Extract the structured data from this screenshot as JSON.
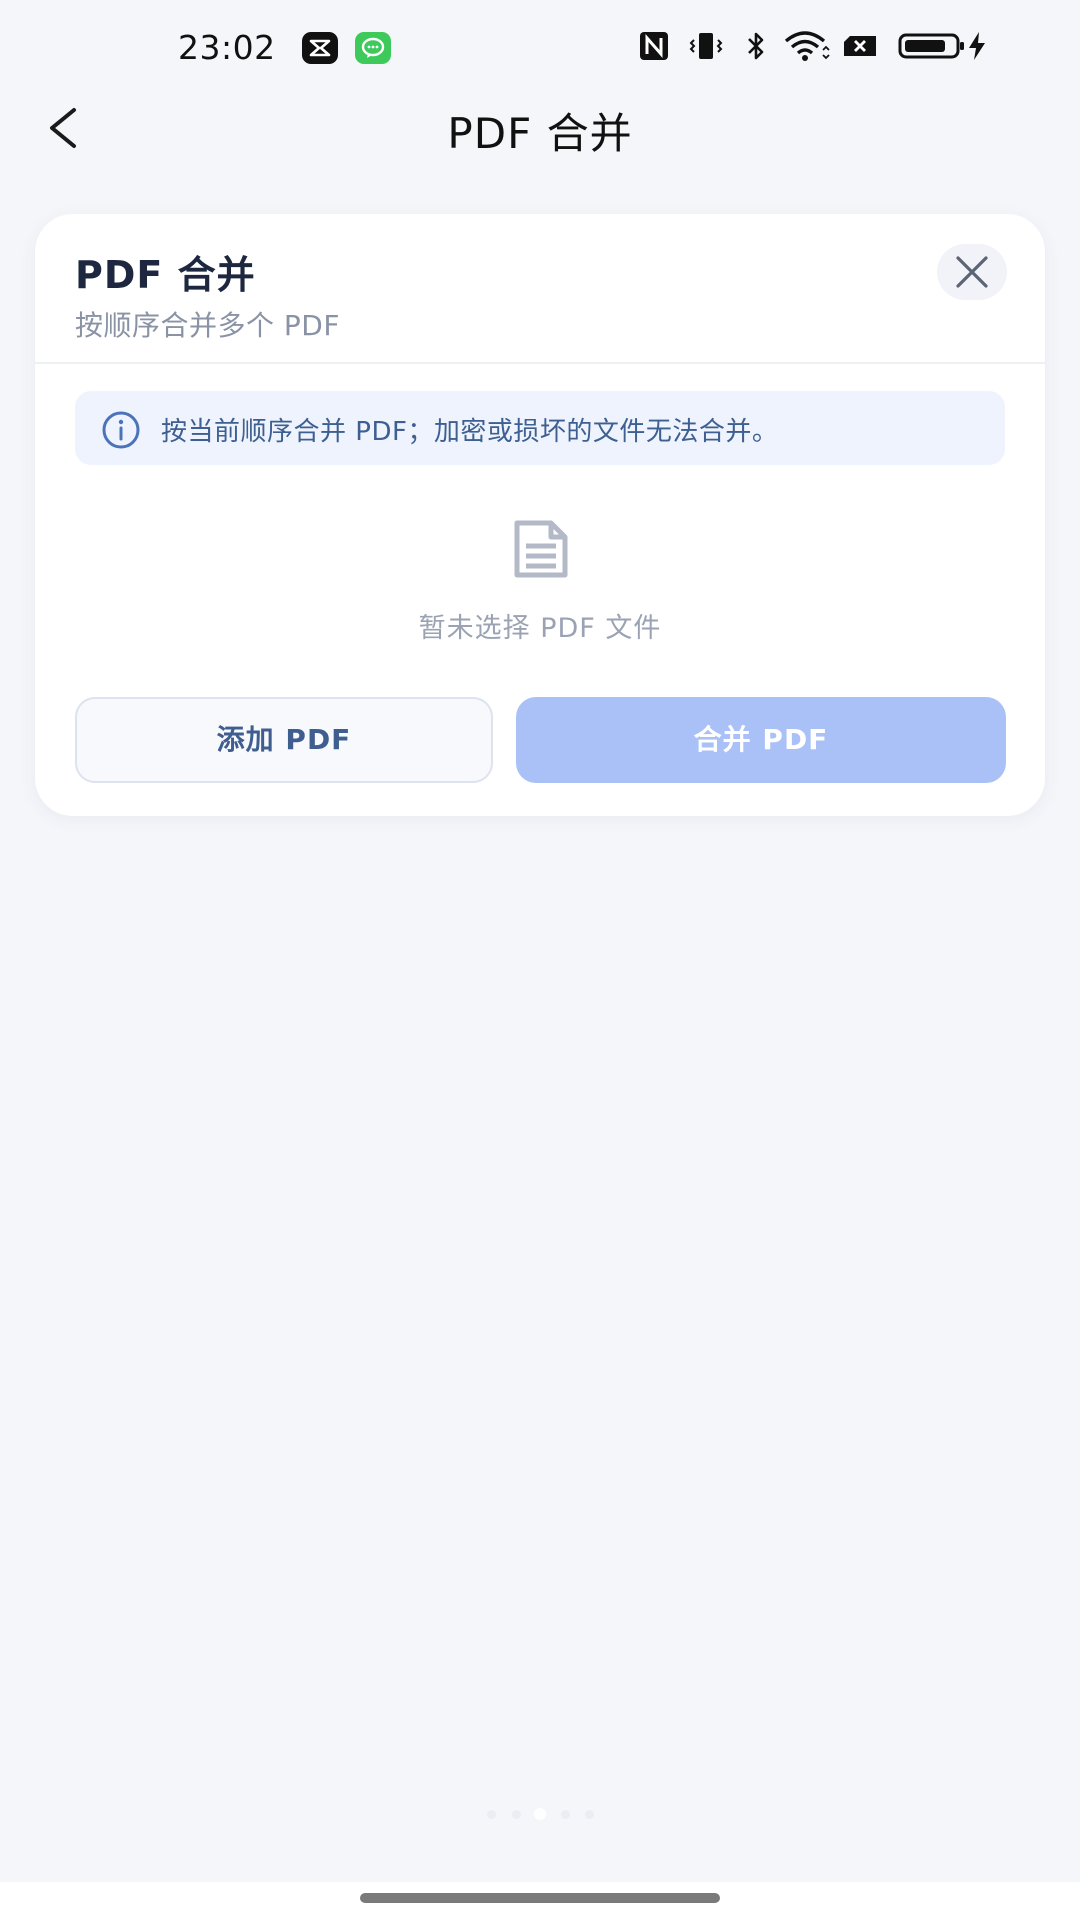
{
  "status_bar": {
    "time": "23:02",
    "left_icons": [
      "capcut-app-icon",
      "chat-app-icon"
    ],
    "right_icons": [
      "nfc-icon",
      "vibrate-icon",
      "bluetooth-icon",
      "wifi-icon",
      "sim-off-icon",
      "battery-icon",
      "charging-icon"
    ],
    "battery_level": 0.75
  },
  "nav": {
    "title": "PDF 合并",
    "back_icon": "chevron-left-icon"
  },
  "card": {
    "title": "PDF 合并",
    "subtitle": "按顺序合并多个 PDF",
    "close_icon": "close-icon",
    "info": {
      "icon": "info-icon",
      "text": "按当前顺序合并 PDF；加密或损坏的文件无法合并。"
    },
    "empty_state": {
      "icon": "document-icon",
      "text": "暂未选择 PDF 文件"
    },
    "buttons": {
      "add_label": "添加 PDF",
      "merge_label": "合并 PDF"
    }
  },
  "pager": {
    "dot_count": 5,
    "active_index": 2
  },
  "colors": {
    "background": "#f5f6fa",
    "card": "#ffffff",
    "info_bg": "#eef3fd",
    "info_text": "#3d5f91",
    "primary_disabled": "#a9c1f6",
    "secondary_text": "#8a93a6"
  }
}
